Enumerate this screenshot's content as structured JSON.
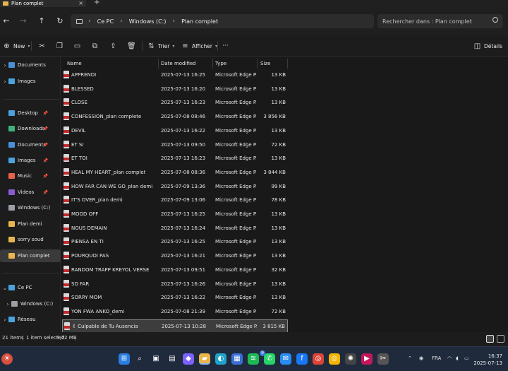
{
  "tab": {
    "title": "Plan complet",
    "close": "×",
    "new_tab": "+"
  },
  "nav": {
    "back": "←",
    "forward": "→",
    "up": "↑",
    "refresh": "↻"
  },
  "breadcrumb": [
    "Ce PC",
    "Windows (C:)",
    "Plan complet"
  ],
  "breadcrumb_sep": "›",
  "search": {
    "placeholder": "Rechercher dans : Plan complet"
  },
  "toolbar": {
    "new_label": "New",
    "sort_label": "Trier",
    "view_label": "Afficher",
    "more_label": "···",
    "details_label": "Détails"
  },
  "sidebar": {
    "top_items": [
      {
        "label": "Documents",
        "icon": "documents-icon",
        "color": "#4a90d9"
      },
      {
        "label": "Images",
        "icon": "images-icon",
        "color": "#4aa3df"
      }
    ],
    "quick_items": [
      {
        "label": "Desktop",
        "icon": "desktop-icon",
        "color": "#4aa3df",
        "pinned": true
      },
      {
        "label": "Downloads",
        "icon": "downloads-icon",
        "color": "#3fb37f",
        "pinned": true
      },
      {
        "label": "Documents",
        "icon": "documents-icon",
        "color": "#4a90d9",
        "pinned": true
      },
      {
        "label": "Images",
        "icon": "images-icon",
        "color": "#4aa3df",
        "pinned": true
      },
      {
        "label": "Music",
        "icon": "music-icon",
        "color": "#e8634a",
        "pinned": true
      },
      {
        "label": "Videos",
        "icon": "videos-icon",
        "color": "#8a5cd0",
        "pinned": true
      },
      {
        "label": "Windows (C:)",
        "icon": "drive-icon",
        "color": "#9aa0a6",
        "pinned": false
      },
      {
        "label": "Plan demi",
        "icon": "folder-icon",
        "color": "#e8b64c",
        "pinned": false
      },
      {
        "label": "sorry soud",
        "icon": "folder-icon",
        "color": "#e8b64c",
        "pinned": false
      },
      {
        "label": "Plan complet",
        "icon": "folder-icon",
        "color": "#e8b64c",
        "pinned": false,
        "selected": true
      }
    ],
    "tree_items": [
      {
        "label": "Ce PC",
        "icon": "pc-icon",
        "color": "#4aa3df",
        "expanded": true
      },
      {
        "label": "Windows (C:)",
        "icon": "drive-icon",
        "color": "#9aa0a6"
      },
      {
        "label": "Réseau",
        "icon": "network-icon",
        "color": "#4aa3df"
      }
    ]
  },
  "columns": {
    "name": "Name",
    "date": "Date modified",
    "type": "Type",
    "size": "Size"
  },
  "files": [
    {
      "name": "APPRENDI",
      "date": "2025-07-13 16:25",
      "type": "Microsoft Edge P...",
      "size": "13 KB"
    },
    {
      "name": "BLESSED",
      "date": "2025-07-13 16:20",
      "type": "Microsoft Edge P...",
      "size": "13 KB"
    },
    {
      "name": "CLOSE",
      "date": "2025-07-13 16:23",
      "type": "Microsoft Edge P...",
      "size": "13 KB"
    },
    {
      "name": "CONFESSION_plan complete",
      "date": "2025-07-08 08:46",
      "type": "Microsoft Edge P...",
      "size": "3 856 KB"
    },
    {
      "name": "DEVIL",
      "date": "2025-07-13 16:22",
      "type": "Microsoft Edge P...",
      "size": "13 KB"
    },
    {
      "name": "ET SI",
      "date": "2025-07-13 09:50",
      "type": "Microsoft Edge P...",
      "size": "72 KB"
    },
    {
      "name": "ET TOI",
      "date": "2025-07-13 16:23",
      "type": "Microsoft Edge P...",
      "size": "13 KB"
    },
    {
      "name": "HEAL MY HEART_plan complet",
      "date": "2025-07-08 08:36",
      "type": "Microsoft Edge P...",
      "size": "3 844 KB"
    },
    {
      "name": "HOW FAR CAN WE GO_plan demi",
      "date": "2025-07-09 13:36",
      "type": "Microsoft Edge P...",
      "size": "99 KB"
    },
    {
      "name": "IT'S OVER_plan demi",
      "date": "2025-07-09 13:06",
      "type": "Microsoft Edge P...",
      "size": "78 KB"
    },
    {
      "name": "MOOD OFF",
      "date": "2025-07-13 16:25",
      "type": "Microsoft Edge P...",
      "size": "13 KB"
    },
    {
      "name": "NOUS DEMAIN",
      "date": "2025-07-13 16:24",
      "type": "Microsoft Edge P...",
      "size": "13 KB"
    },
    {
      "name": "PIENSA EN TI",
      "date": "2025-07-13 16:25",
      "type": "Microsoft Edge P...",
      "size": "13 KB"
    },
    {
      "name": "POURQUOI PAS",
      "date": "2025-07-13 16:21",
      "type": "Microsoft Edge P...",
      "size": "13 KB"
    },
    {
      "name": "RANDOM TRAPP KREYOL VERSE",
      "date": "2025-07-13 09:51",
      "type": "Microsoft Edge P...",
      "size": "32 KB"
    },
    {
      "name": "SO FAR",
      "date": "2025-07-13 16:26",
      "type": "Microsoft Edge P...",
      "size": "13 KB"
    },
    {
      "name": "SORRY MOM",
      "date": "2025-07-13 16:22",
      "type": "Microsoft Edge P...",
      "size": "13 KB"
    },
    {
      "name": "YON FWA ANKO_demi",
      "date": "2025-07-08 21:39",
      "type": "Microsoft Edge P...",
      "size": "72 KB"
    },
    {
      "name": "✌ Culpable de Tu Ausencia",
      "date": "2025-07-13 10:28",
      "type": "Microsoft Edge P...",
      "size": "3 815 KB",
      "selected": true
    }
  ],
  "status": {
    "items": "21 items",
    "selected": "1 item selected",
    "size": "3,72 MB",
    "sep": "|"
  },
  "taskbar": {
    "lang": "FRA",
    "time": "16:37",
    "date": "2025-07-13",
    "badge_count": "9",
    "apps": [
      {
        "icon": "start-icon",
        "glyph": "⊞",
        "color": "#2a7de1"
      },
      {
        "icon": "search-icon",
        "glyph": "⌕",
        "color": "transparent"
      },
      {
        "icon": "task-view-icon",
        "glyph": "▣",
        "color": "transparent"
      },
      {
        "icon": "widgets-icon",
        "glyph": "▤",
        "color": "transparent"
      },
      {
        "icon": "copilot-icon",
        "glyph": "◆",
        "color": "#7b61ff"
      },
      {
        "icon": "file-explorer-icon",
        "glyph": "▰",
        "color": "#e8b64c"
      },
      {
        "icon": "edge-icon",
        "glyph": "◐",
        "color": "#1fa3c9"
      },
      {
        "icon": "store-icon",
        "glyph": "▦",
        "color": "#3a6fd8"
      },
      {
        "icon": "spotify-icon",
        "glyph": "≋",
        "color": "#1db954"
      },
      {
        "icon": "whatsapp-icon",
        "glyph": "✆",
        "color": "#25d366"
      },
      {
        "icon": "messenger-icon",
        "glyph": "✉",
        "color": "#2a8bf2"
      },
      {
        "icon": "facebook-icon",
        "glyph": "f",
        "color": "#1877f2"
      },
      {
        "icon": "chrome-icon",
        "glyph": "◎",
        "color": "#db4437"
      },
      {
        "icon": "chrome-profile-icon",
        "glyph": "◎",
        "color": "#f4b400"
      },
      {
        "icon": "chatgpt-icon",
        "glyph": "✺",
        "color": "#444"
      },
      {
        "icon": "media-player-icon",
        "glyph": "▶",
        "color": "#c2185b"
      },
      {
        "icon": "snipping-icon",
        "glyph": "✂",
        "color": "#555"
      }
    ]
  }
}
